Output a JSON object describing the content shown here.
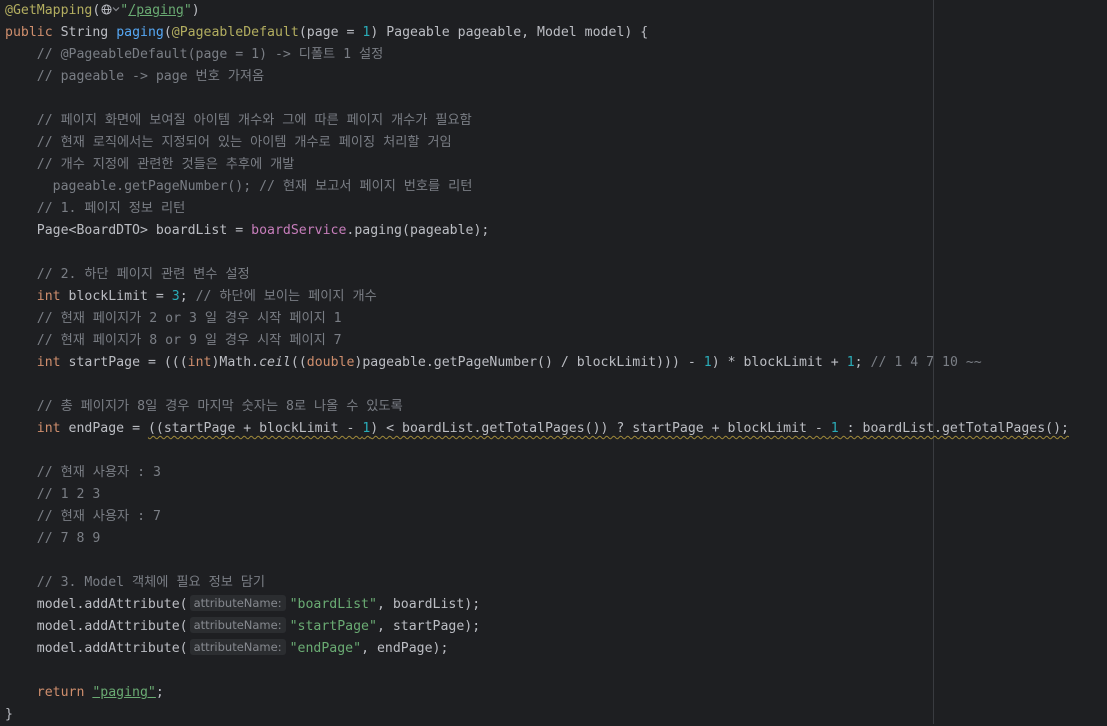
{
  "code": {
    "annotation_name": "@GetMapping",
    "mapping_url": "/paging",
    "globe_icon": "globe-icon",
    "chevron_icon": "chevron-down-icon",
    "signature": {
      "kw_public": "public",
      "type_string": "String",
      "method_name": "paging",
      "param_annotation": "@PageableDefault",
      "page_eq": "page = ",
      "page_default": "1",
      "rest": ") Pageable pageable, Model model) {"
    },
    "comments": {
      "c1": "// @PageableDefault(page = 1) -> 디폴트 1 설정",
      "c2": "// pageable -> page 번호 가져옴",
      "c3": "// 페이지 화면에 보여질 아이템 개수와 그에 따른 페이지 개수가 필요함",
      "c4": "// 현재 로직에서는 지정되어 있는 아이템 개수로 페이징 처리할 거임",
      "c5": "// 개수 지정에 관련한 것들은 추후에 개발",
      "c6": "// 현재 보고서 페이지 번호를 리턴",
      "c7": "// 1. 페이지 정보 리턴",
      "c8": "// 2. 하단 페이지 관련 변수 설정",
      "c9": "// 하단에 보이는 페이지 개수",
      "c10": "// 현재 페이지가 2 or 3 일 경우 시작 페이지 1",
      "c11": "// 현재 페이지가 8 or 9 일 경우 시작 페이지 7",
      "c12": "// 1 4 7 10 ~~",
      "c13": "// 총 페이지가 8일 경우 마지막 숫자는 8로 나올 수 있도록",
      "c14": "// 현재 사용자 : 3",
      "c15": "// 1 2 3",
      "c16": "// 현재 사용자 : 7",
      "c17": "// 7 8 9",
      "c18": "// 3. Model 객체에 필요 정보 담기"
    },
    "stmt_get_page_number": "pageable.getPageNumber();",
    "stmt_board_list_prefix": "Page<BoardDTO> boardList = ",
    "board_service_field": "boardService",
    "stmt_board_list_suffix": ".paging(pageable);",
    "kw_int": "int",
    "block_limit_decl": "blockLimit = ",
    "block_limit_value": "3",
    "start_page": {
      "p1": "startPage = (((",
      "cast_int": "int",
      "p2": ")Math.",
      "ceil": "ceil",
      "p3": "((",
      "cast_double": "double",
      "p4": ")pageable.getPageNumber() / blockLimit))) - ",
      "one_a": "1",
      "p5": ") * blockLimit + ",
      "one_b": "1",
      "p6": ";"
    },
    "end_page": {
      "p1": "endPage = ",
      "p2": "((startPage + blockLimit - ",
      "one_a": "1",
      "p3": ") < boardList.getTotalPages()) ? startPage + blockLimit - ",
      "one_b": "1",
      "p4": " : boardList.getTotalPages();"
    },
    "add_attr_prefix": "model.addAttribute(",
    "hint_label": "attributeName:",
    "attr_board_list": "\"boardList\"",
    "attr_board_list_rest": ", boardList);",
    "attr_start_page": "\"startPage\"",
    "attr_start_page_rest": ", startPage);",
    "attr_end_page": "\"endPage\"",
    "attr_end_page_rest": ", endPage);",
    "kw_return": "return",
    "return_value": "\"paging\"",
    "semicolon": ";",
    "close_brace": "}"
  }
}
